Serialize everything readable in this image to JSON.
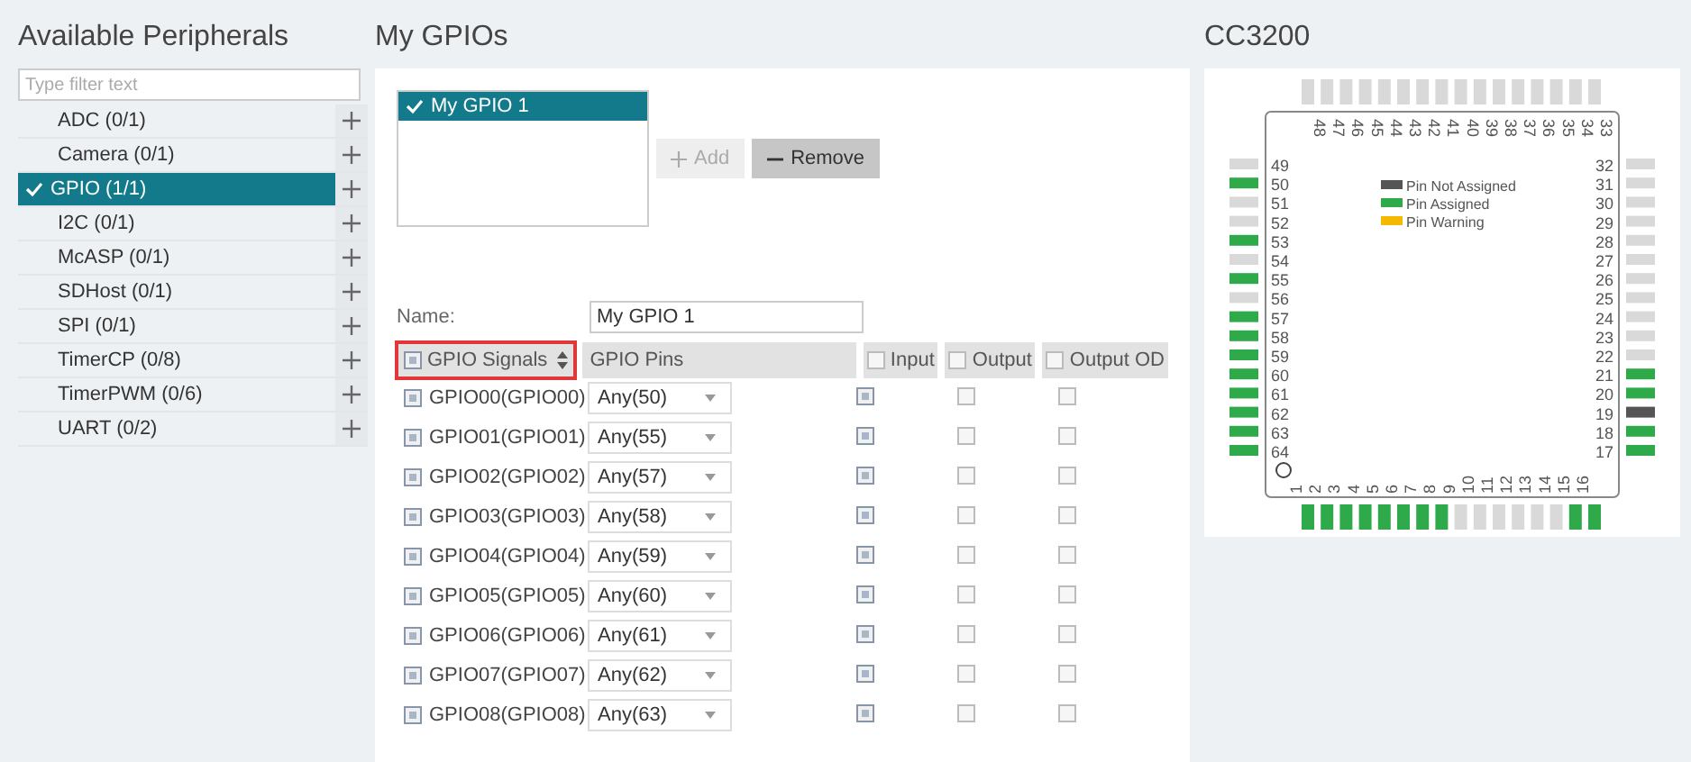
{
  "peripherals": {
    "title": "Available Peripherals",
    "filter": {
      "placeholder": "Type filter text"
    },
    "items": [
      {
        "label": "ADC (0/1)",
        "selected": false
      },
      {
        "label": "Camera (0/1)",
        "selected": false
      },
      {
        "label": "GPIO (1/1)",
        "selected": true
      },
      {
        "label": "I2C (0/1)",
        "selected": false
      },
      {
        "label": "McASP (0/1)",
        "selected": false
      },
      {
        "label": "SDHost (0/1)",
        "selected": false
      },
      {
        "label": "SPI (0/1)",
        "selected": false
      },
      {
        "label": "TimerCP (0/8)",
        "selected": false
      },
      {
        "label": "TimerPWM (0/6)",
        "selected": false
      },
      {
        "label": "UART (0/2)",
        "selected": false
      }
    ]
  },
  "gpios": {
    "title": "My GPIOs",
    "instances": [
      {
        "label": "My GPIO 1",
        "selected": true
      }
    ],
    "buttons": [
      {
        "label": "Add",
        "kind": "add",
        "disabled": true
      },
      {
        "label": "Remove",
        "kind": "remove",
        "disabled": false
      }
    ],
    "name": {
      "label": "Name:",
      "value": "My GPIO 1"
    },
    "table": {
      "columns": [
        {
          "label": "GPIO Signals",
          "checked": true,
          "kind": "signal"
        },
        {
          "label": "GPIO Pins",
          "kind": "pin"
        },
        {
          "label": "Input",
          "checked": false,
          "kind": "flag"
        },
        {
          "label": "Output",
          "checked": false,
          "kind": "flag"
        },
        {
          "label": "Output OD",
          "checked": false,
          "kind": "flag"
        }
      ],
      "rows": [
        {
          "signal": "GPIO00(GPIO00)",
          "checked": true,
          "pin": "Any(50)",
          "input": true,
          "output": false,
          "output_od": false
        },
        {
          "signal": "GPIO01(GPIO01)",
          "checked": true,
          "pin": "Any(55)",
          "input": true,
          "output": false,
          "output_od": false
        },
        {
          "signal": "GPIO02(GPIO02)",
          "checked": true,
          "pin": "Any(57)",
          "input": true,
          "output": false,
          "output_od": false
        },
        {
          "signal": "GPIO03(GPIO03)",
          "checked": true,
          "pin": "Any(58)",
          "input": true,
          "output": false,
          "output_od": false
        },
        {
          "signal": "GPIO04(GPIO04)",
          "checked": true,
          "pin": "Any(59)",
          "input": true,
          "output": false,
          "output_od": false
        },
        {
          "signal": "GPIO05(GPIO05)",
          "checked": true,
          "pin": "Any(60)",
          "input": true,
          "output": false,
          "output_od": false
        },
        {
          "signal": "GPIO06(GPIO06)",
          "checked": true,
          "pin": "Any(61)",
          "input": true,
          "output": false,
          "output_od": false
        },
        {
          "signal": "GPIO07(GPIO07)",
          "checked": true,
          "pin": "Any(62)",
          "input": true,
          "output": false,
          "output_od": false
        },
        {
          "signal": "GPIO08(GPIO08)",
          "checked": true,
          "pin": "Any(63)",
          "input": true,
          "output": false,
          "output_od": false
        }
      ]
    }
  },
  "chip": {
    "title": "CC3200",
    "legend": [
      {
        "label": "Pin Not Assigned",
        "color": "#555555"
      },
      {
        "label": "Pin Assigned",
        "color": "#2eaa4a"
      },
      {
        "label": "Pin Warning",
        "color": "#f5b800"
      }
    ],
    "pins": {
      "top": [
        {
          "number": "48",
          "color": "#d9d9d9"
        },
        {
          "number": "47",
          "color": "#d9d9d9"
        },
        {
          "number": "46",
          "color": "#d9d9d9"
        },
        {
          "number": "45",
          "color": "#d9d9d9"
        },
        {
          "number": "44",
          "color": "#d9d9d9"
        },
        {
          "number": "43",
          "color": "#d9d9d9"
        },
        {
          "number": "42",
          "color": "#d9d9d9"
        },
        {
          "number": "41",
          "color": "#d9d9d9"
        },
        {
          "number": "40",
          "color": "#d9d9d9"
        },
        {
          "number": "39",
          "color": "#d9d9d9"
        },
        {
          "number": "38",
          "color": "#d9d9d9"
        },
        {
          "number": "37",
          "color": "#d9d9d9"
        },
        {
          "number": "36",
          "color": "#d9d9d9"
        },
        {
          "number": "35",
          "color": "#d9d9d9"
        },
        {
          "number": "34",
          "color": "#d9d9d9"
        },
        {
          "number": "33",
          "color": "#d9d9d9"
        }
      ],
      "left": [
        {
          "number": "49",
          "color": "#d9d9d9"
        },
        {
          "number": "50",
          "color": "#2eaa4a"
        },
        {
          "number": "51",
          "color": "#d9d9d9"
        },
        {
          "number": "52",
          "color": "#d9d9d9"
        },
        {
          "number": "53",
          "color": "#2eaa4a"
        },
        {
          "number": "54",
          "color": "#d9d9d9"
        },
        {
          "number": "55",
          "color": "#2eaa4a"
        },
        {
          "number": "56",
          "color": "#d9d9d9"
        },
        {
          "number": "57",
          "color": "#2eaa4a"
        },
        {
          "number": "58",
          "color": "#2eaa4a"
        },
        {
          "number": "59",
          "color": "#2eaa4a"
        },
        {
          "number": "60",
          "color": "#2eaa4a"
        },
        {
          "number": "61",
          "color": "#2eaa4a"
        },
        {
          "number": "62",
          "color": "#2eaa4a"
        },
        {
          "number": "63",
          "color": "#2eaa4a"
        },
        {
          "number": "64",
          "color": "#2eaa4a"
        }
      ],
      "right": [
        {
          "number": "32",
          "color": "#d9d9d9"
        },
        {
          "number": "31",
          "color": "#d9d9d9"
        },
        {
          "number": "30",
          "color": "#d9d9d9"
        },
        {
          "number": "29",
          "color": "#d9d9d9"
        },
        {
          "number": "28",
          "color": "#d9d9d9"
        },
        {
          "number": "27",
          "color": "#d9d9d9"
        },
        {
          "number": "26",
          "color": "#d9d9d9"
        },
        {
          "number": "25",
          "color": "#d9d9d9"
        },
        {
          "number": "24",
          "color": "#d9d9d9"
        },
        {
          "number": "23",
          "color": "#d9d9d9"
        },
        {
          "number": "22",
          "color": "#d9d9d9"
        },
        {
          "number": "21",
          "color": "#2eaa4a"
        },
        {
          "number": "20",
          "color": "#2eaa4a"
        },
        {
          "number": "19",
          "color": "#555555"
        },
        {
          "number": "18",
          "color": "#2eaa4a"
        },
        {
          "number": "17",
          "color": "#2eaa4a"
        }
      ],
      "bottom": [
        {
          "number": "1",
          "color": "#2eaa4a"
        },
        {
          "number": "2",
          "color": "#2eaa4a"
        },
        {
          "number": "3",
          "color": "#2eaa4a"
        },
        {
          "number": "4",
          "color": "#2eaa4a"
        },
        {
          "number": "5",
          "color": "#2eaa4a"
        },
        {
          "number": "6",
          "color": "#2eaa4a"
        },
        {
          "number": "7",
          "color": "#2eaa4a"
        },
        {
          "number": "8",
          "color": "#2eaa4a"
        },
        {
          "number": "9",
          "color": "#d9d9d9"
        },
        {
          "number": "10",
          "color": "#d9d9d9"
        },
        {
          "number": "11",
          "color": "#d9d9d9"
        },
        {
          "number": "12",
          "color": "#d9d9d9"
        },
        {
          "number": "13",
          "color": "#d9d9d9"
        },
        {
          "number": "14",
          "color": "#d9d9d9"
        },
        {
          "number": "15",
          "color": "#2eaa4a"
        },
        {
          "number": "16",
          "color": "#2eaa4a"
        }
      ]
    }
  }
}
